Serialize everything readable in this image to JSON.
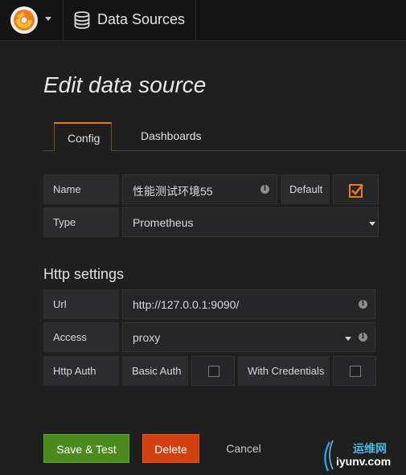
{
  "nav": {
    "breadcrumb_label": "Data Sources"
  },
  "page": {
    "title": "Edit data source"
  },
  "tabs": [
    {
      "label": "Config",
      "active": true
    },
    {
      "label": "Dashboards",
      "active": false
    }
  ],
  "form": {
    "name_label": "Name",
    "name_value": "性能测试环境55",
    "default_label": "Default",
    "default_checked": true,
    "type_label": "Type",
    "type_value": "Prometheus"
  },
  "http": {
    "section_title": "Http settings",
    "url_label": "Url",
    "url_value": "http://127.0.0.1:9090/",
    "access_label": "Access",
    "access_value": "proxy",
    "auth_label": "Http Auth",
    "basic_auth_label": "Basic Auth",
    "basic_auth_checked": false,
    "with_credentials_label": "With Credentials",
    "with_credentials_checked": false
  },
  "actions": {
    "save_label": "Save & Test",
    "delete_label": "Delete",
    "cancel_label": "Cancel"
  },
  "watermark": {
    "line1": "运维网",
    "line2": "iyunv.com"
  },
  "colors": {
    "accent": "#eb7b18",
    "save": "#4c8a1d",
    "delete": "#d1410f",
    "background": "#1f1f20"
  },
  "icons": {
    "logo": "grafana-logo-icon",
    "breadcrumb": "database-icon",
    "info": "info-icon",
    "dropdown": "caret-down-icon",
    "checkbox": "checkbox-icon"
  }
}
